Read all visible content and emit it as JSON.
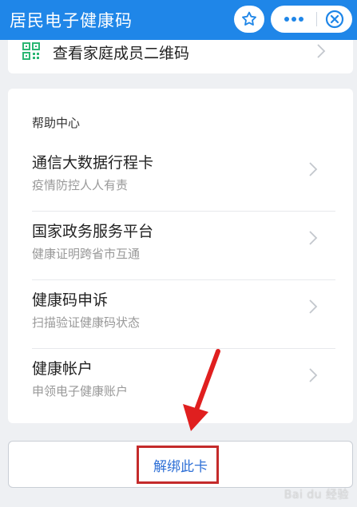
{
  "header": {
    "title": "居民电子健康码"
  },
  "family_card": {
    "label": "查看家庭成员二维码"
  },
  "help": {
    "heading": "帮助中心",
    "items": [
      {
        "title": "通信大数据行程卡",
        "subtitle": "疫情防控人人有责"
      },
      {
        "title": "国家政务服务平台",
        "subtitle": "健康证明跨省市互通"
      },
      {
        "title": "健康码申诉",
        "subtitle": "扫描验证健康码状态"
      },
      {
        "title": "健康帐户",
        "subtitle": "申领电子健康账户"
      }
    ]
  },
  "unbind": {
    "label": "解绑此卡"
  },
  "watermark": {
    "text": "Bai du 经验"
  },
  "colors": {
    "header_bg": "#1f86e8",
    "link_blue": "#2d6fd6",
    "annotation_red": "#c42b2b",
    "qr_green": "#2bb673"
  },
  "icons": [
    "star-icon",
    "more-icon",
    "close-icon",
    "qr-icon",
    "chevron-right-icon",
    "annotation-arrow-icon"
  ]
}
